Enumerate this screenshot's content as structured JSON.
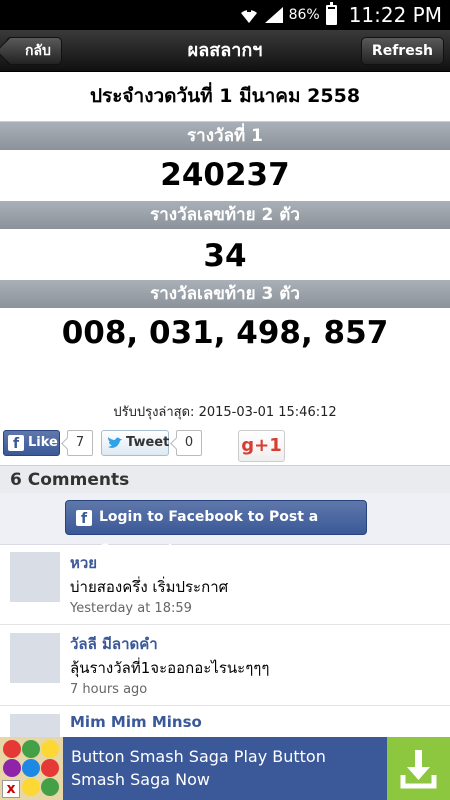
{
  "status_bar": {
    "battery_percent": "86%",
    "battery_level": 0.86,
    "time": "11:22 PM",
    "icons": [
      "wifi-icon",
      "signal-icon",
      "battery-icon"
    ]
  },
  "navbar": {
    "back_label": "กลับ",
    "title": "ผลสลากฯ",
    "refresh_label": "Refresh"
  },
  "draw": {
    "date_label": "ประจำงวดวันที่ 1 มีนาคม 2558"
  },
  "prizes": [
    {
      "label": "รางวัลที่ 1",
      "value": "240237"
    },
    {
      "label": "รางวัลเลขท้าย 2 ตัว",
      "value": "34"
    },
    {
      "label": "รางวัลเลขท้าย 3 ตัว",
      "value": "008, 031, 498, 857"
    }
  ],
  "updated": "ปรับปรุงล่าสุด: 2015-03-01 15:46:12",
  "social": {
    "like_label": "Like",
    "like_count": "7",
    "tweet_label": "Tweet",
    "tweet_count": "0",
    "gplus_label": "g+1"
  },
  "comments": {
    "header": "6 Comments",
    "login_label": "Login to Facebook to Post a Comment",
    "items": [
      {
        "name": "หวย",
        "text": "บ่ายสองครึ่ง เริ่มประกาศ",
        "time": "Yesterday at 18:59"
      },
      {
        "name": "วัลลี มีลาดคำ",
        "text": "ลุ้นรางวัลที่1จะออกอะไรนะๆๆๆ",
        "time": "7 hours ago"
      },
      {
        "name": "Mim Mim Minso",
        "text": "",
        "time": ""
      }
    ]
  },
  "ad": {
    "text": "Button Smash Saga Play Button Smash Saga Now",
    "close_label": "x",
    "colors": {
      "banner": "#3b5998",
      "download": "#8dc63f"
    }
  },
  "colors": {
    "nav_gradient_top": "#3a3a3a",
    "prize_header": "#9aa1a9",
    "facebook_blue": "#3b5998",
    "name_link": "#3b5998"
  }
}
